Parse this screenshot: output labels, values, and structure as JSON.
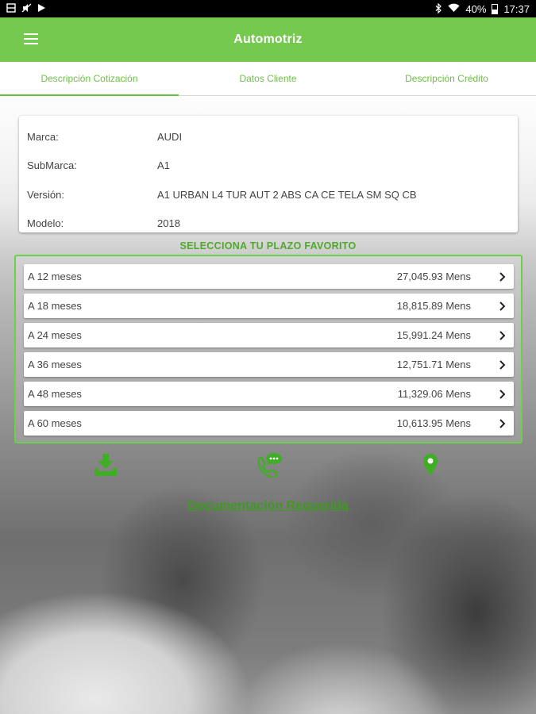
{
  "status_bar": {
    "time": "17:37",
    "battery": "40%",
    "left_icons": [
      "gallery-icon",
      "mute-icon",
      "play-store-icon"
    ],
    "right_icons": [
      "bluetooth-icon",
      "wifi-icon",
      "battery-icon"
    ]
  },
  "app_bar": {
    "title": "Automotriz",
    "color": "#76c94f"
  },
  "tabs": [
    {
      "label": "Descripción Cotización",
      "active": true
    },
    {
      "label": "Datos Cliente",
      "active": false
    },
    {
      "label": "Descripción Crédito",
      "active": false
    }
  ],
  "vehicle": {
    "rows": [
      {
        "label": "Marca:",
        "value": "AUDI"
      },
      {
        "label": "SubMarca:",
        "value": "A1"
      },
      {
        "label": "Versión:",
        "value": "A1 URBAN L4 TUR AUT 2 ABS CA CE TELA SM SQ CB"
      },
      {
        "label": "Modelo:",
        "value": "2018"
      }
    ]
  },
  "plazo": {
    "heading": "SELECCIONA TU PLAZO FAVORITO",
    "items": [
      {
        "term": "A 12 meses",
        "amount": "27,045.93 Mens"
      },
      {
        "term": "A 18 meses",
        "amount": "18,815.89 Mens"
      },
      {
        "term": "A 24 meses",
        "amount": "15,991.24 Mens"
      },
      {
        "term": "A 36 meses",
        "amount": "12,751.71 Mens"
      },
      {
        "term": "A 48 meses",
        "amount": "11,329.06 Mens"
      },
      {
        "term": "A 60 meses",
        "amount": "10,613.95 Mens"
      }
    ]
  },
  "actions": {
    "icons": [
      "download-icon",
      "phone-chat-icon",
      "location-pin-icon"
    ],
    "doc_link": "Documentación Requerida"
  },
  "colors": {
    "accent": "#76c94f",
    "accent_dark": "#3f9a22",
    "border_green": "#6cd04a"
  }
}
